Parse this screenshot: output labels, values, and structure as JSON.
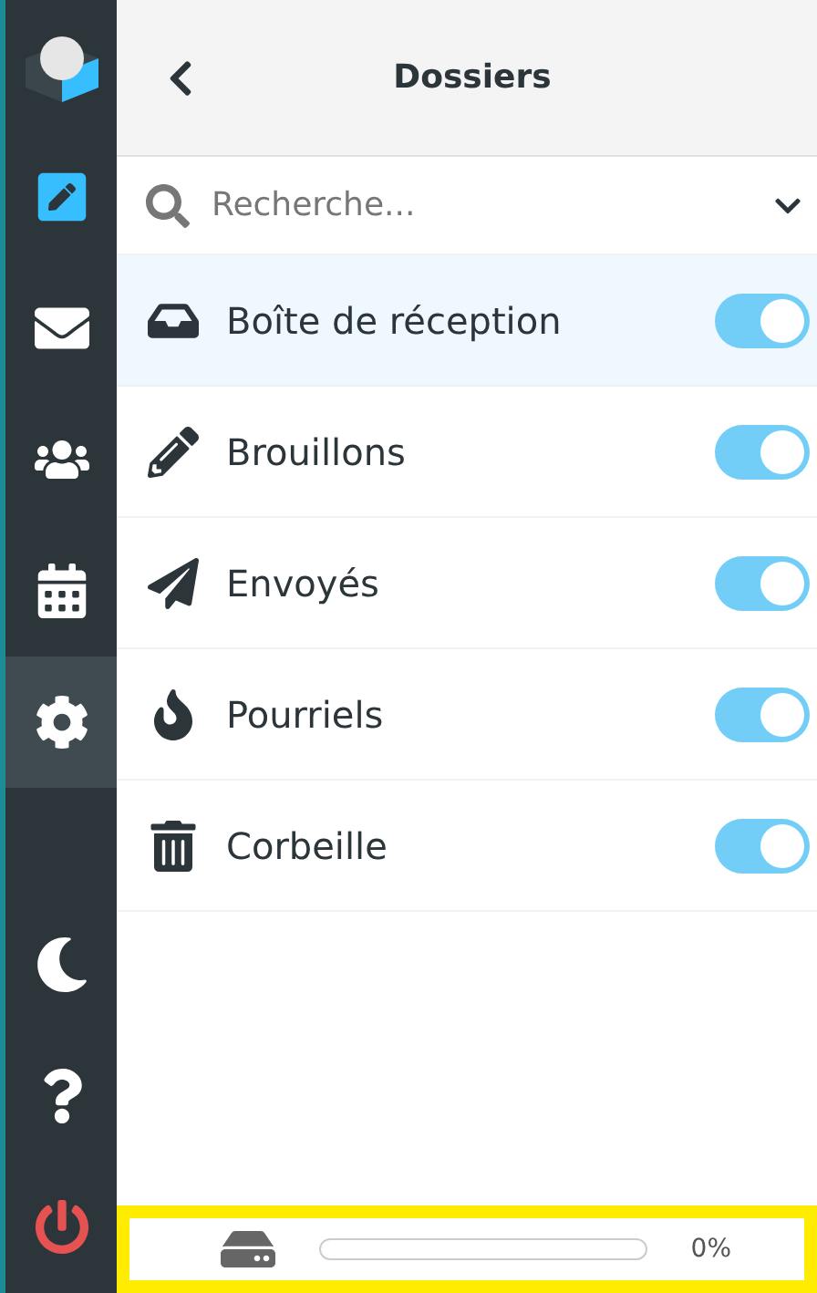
{
  "sidebar": {
    "items": [
      {
        "kind": "compose",
        "selected": false
      },
      {
        "kind": "mail",
        "selected": false
      },
      {
        "kind": "contacts",
        "selected": false
      },
      {
        "kind": "calendar",
        "selected": false
      },
      {
        "kind": "settings",
        "selected": true
      }
    ],
    "bottom_items": [
      {
        "kind": "dark-mode"
      },
      {
        "kind": "help"
      },
      {
        "kind": "logout"
      }
    ]
  },
  "header": {
    "title": "Dossiers"
  },
  "search": {
    "placeholder": "Recherche..."
  },
  "folders": [
    {
      "kind": "inbox",
      "name": "Boîte de réception",
      "selected": true,
      "on": true
    },
    {
      "kind": "drafts",
      "name": "Brouillons",
      "selected": false,
      "on": true
    },
    {
      "kind": "sent",
      "name": "Envoyés",
      "selected": false,
      "on": true
    },
    {
      "kind": "junk",
      "name": "Pourriels",
      "selected": false,
      "on": true
    },
    {
      "kind": "trash",
      "name": "Corbeille",
      "selected": false,
      "on": true
    }
  ],
  "storage": {
    "level": 0,
    "reading": "0%"
  }
}
